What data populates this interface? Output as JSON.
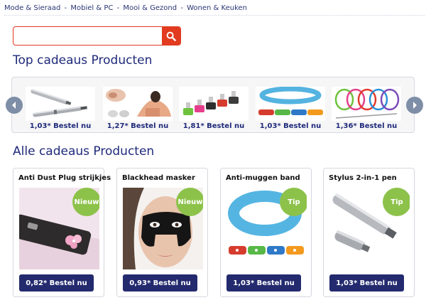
{
  "nav": {
    "links": [
      "Mode & Sieraad",
      "Mobiel & PC",
      "Mooi & Gezond",
      "Wonen & Keuken"
    ],
    "separator": "-"
  },
  "search": {
    "value": "",
    "placeholder": ""
  },
  "top_section": {
    "title": "Top cadeaus Producten",
    "items": [
      {
        "label": "1,03* Bestel nu",
        "icon": "stylus-pen-image"
      },
      {
        "label": "1,27* Bestel nu",
        "icon": "blackhead-mask-image"
      },
      {
        "label": "1,81* Bestel nu",
        "icon": "usb-plugs-image"
      },
      {
        "label": "1,03* Bestel nu",
        "icon": "mosquito-band-image"
      },
      {
        "label": "1,36* Bestel nu",
        "icon": "cable-ties-image"
      }
    ]
  },
  "all_section": {
    "title": "Alle cadeaus Producten",
    "cards": [
      {
        "title": "Anti Dust Plug strijkjes",
        "badge": "Nieuw",
        "buy": "0,82* Bestel nu"
      },
      {
        "title": "Blackhead masker",
        "badge": "Nieuw",
        "buy": "0,93* Bestel nu"
      },
      {
        "title": "Anti-muggen band",
        "badge": "Tip",
        "buy": "1,03* Bestel nu"
      },
      {
        "title": "Stylus 2-in-1 pen",
        "badge": "Tip",
        "buy": "1,03* Bestel nu"
      }
    ]
  },
  "colors": {
    "title": "#1f2a7a",
    "button": "#232a6e",
    "badge": "#8dc24a",
    "search_accent": "#e23b1f",
    "arrow": "#7d8ea6"
  }
}
